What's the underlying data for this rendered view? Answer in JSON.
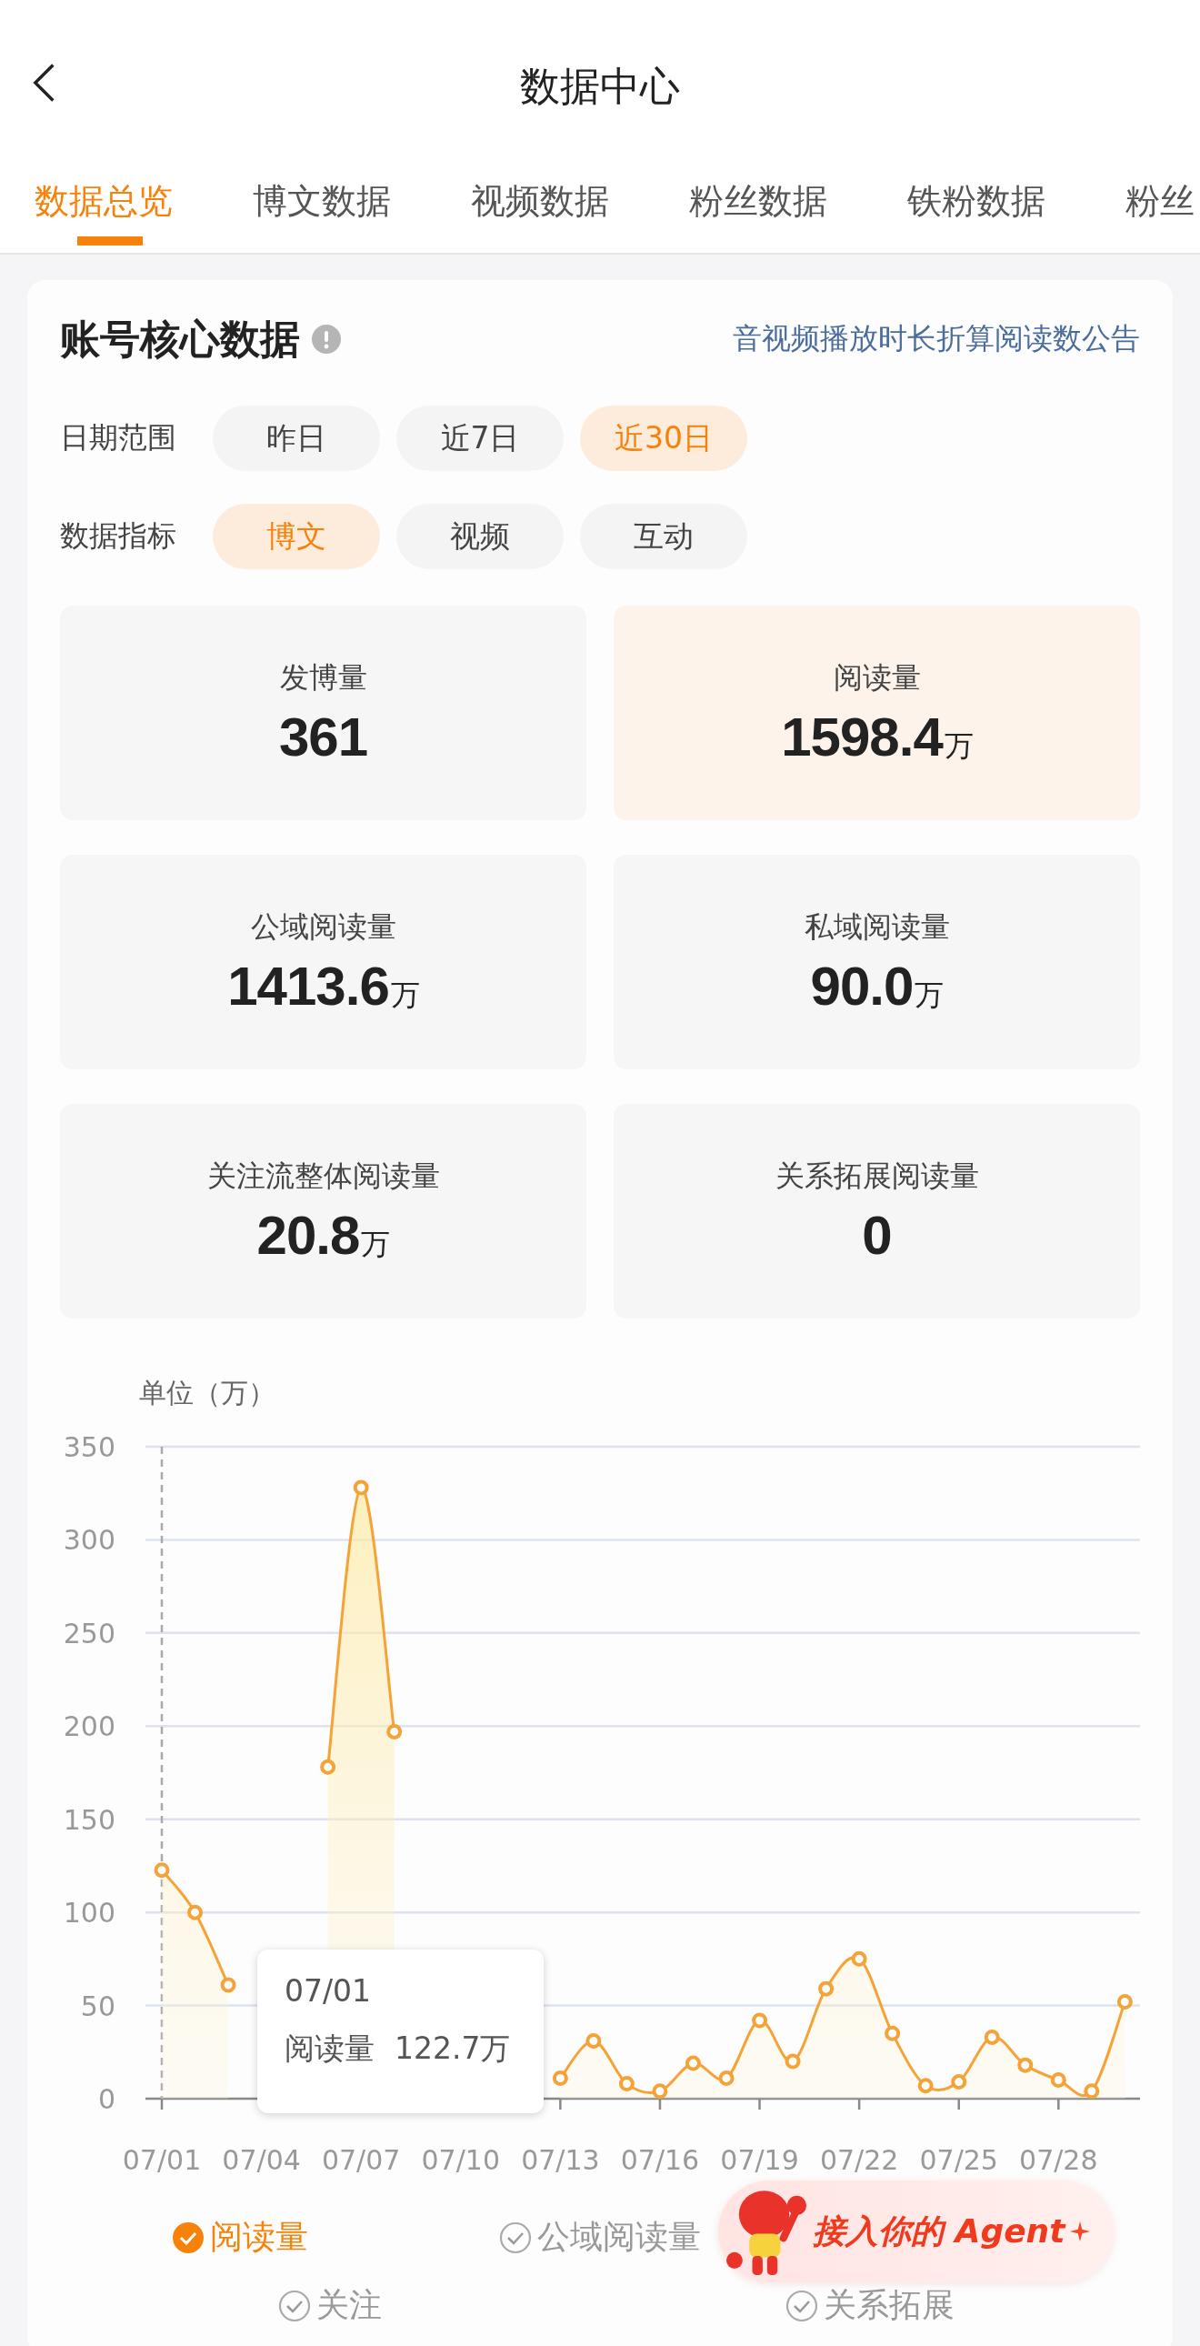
{
  "header": {
    "title": "数据中心"
  },
  "tabs": [
    {
      "label": "数据总览",
      "selected": true
    },
    {
      "label": "博文数据",
      "selected": false
    },
    {
      "label": "视频数据",
      "selected": false
    },
    {
      "label": "粉丝数据",
      "selected": false
    },
    {
      "label": "铁粉数据",
      "selected": false
    },
    {
      "label": "粉丝",
      "selected": false
    }
  ],
  "card": {
    "title": "账号核心数据",
    "link": "音视频播放时长折算阅读数公告"
  },
  "filters": [
    {
      "label": "日期范围",
      "options": [
        {
          "label": "昨日",
          "selected": false
        },
        {
          "label": "近7日",
          "selected": false
        },
        {
          "label": "近30日",
          "selected": true
        }
      ]
    },
    {
      "label": "数据指标",
      "options": [
        {
          "label": "博文",
          "selected": true
        },
        {
          "label": "视频",
          "selected": false
        },
        {
          "label": "互动",
          "selected": false
        }
      ]
    }
  ],
  "metrics": [
    {
      "label": "发博量",
      "value": "361",
      "selected": false
    },
    {
      "label": "阅读量",
      "value": "1598.4",
      "unit": "万",
      "selected": true
    },
    {
      "label": "公域阅读量",
      "value": "1413.6",
      "unit": "万",
      "selected": false
    },
    {
      "label": "私域阅读量",
      "value": "90.0",
      "unit": "万",
      "selected": false
    },
    {
      "label": "关注流整体阅读量",
      "value": "20.8",
      "unit": "万",
      "selected": false
    },
    {
      "label": "关系拓展阅读量",
      "value": "0",
      "selected": false
    }
  ],
  "chart": {
    "chart_data": {
      "type": "area",
      "ylabel": "单位（万）",
      "grid": true,
      "categories": [
        "07/01",
        null,
        null,
        "07/04",
        null,
        null,
        "07/07",
        null,
        null,
        "07/10",
        null,
        null,
        "07/13",
        null,
        null,
        "07/16",
        null,
        null,
        "07/19",
        null,
        null,
        "07/22",
        null,
        null,
        "07/25",
        null,
        null,
        "07/28",
        null,
        null
      ],
      "series": [
        {
          "name": "阅读量",
          "color": "#f5a236",
          "values": [
            122.7,
            100,
            61,
            null,
            null,
            178,
            328,
            197,
            null,
            null,
            null,
            null,
            11,
            31,
            8,
            4,
            19,
            11,
            42,
            20,
            59,
            75,
            35,
            7,
            9,
            33,
            18,
            10,
            4,
            52
          ]
        }
      ],
      "ylim": [
        0,
        350
      ],
      "yticks": [
        0,
        50,
        100,
        150,
        200,
        250,
        300,
        350
      ]
    },
    "tooltip": {
      "date": "07/01",
      "value": "122.7万"
    },
    "legend": [
      {
        "label": "阅读量",
        "checked": true
      },
      {
        "label": "公域阅读量",
        "checked": false
      },
      {
        "label": "关注",
        "checked": false
      },
      {
        "label": "关系拓展",
        "checked": false
      }
    ]
  },
  "agent_button": {
    "label": "接入你的 Agent"
  }
}
